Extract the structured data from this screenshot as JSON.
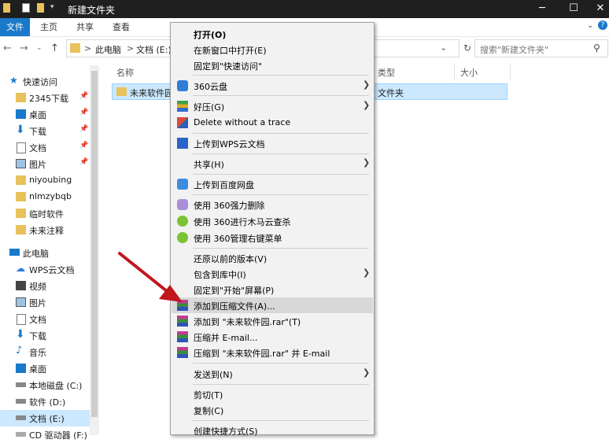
{
  "window": {
    "title": "新建文件夹"
  },
  "ribbon": {
    "tabs": [
      "文件",
      "主页",
      "共享",
      "查看"
    ]
  },
  "address": {
    "parts": [
      "此电脑",
      "文档 (E:)"
    ],
    "sep": ">",
    "search_placeholder": "搜索\"新建文件夹\""
  },
  "nav": {
    "quick_access": "快速访问",
    "items": [
      {
        "label": "2345下载",
        "pinned": true
      },
      {
        "label": "桌面",
        "pinned": true
      },
      {
        "label": "下载",
        "pinned": true
      },
      {
        "label": "文档",
        "pinned": true
      },
      {
        "label": "图片",
        "pinned": true
      },
      {
        "label": "niyoubing",
        "pinned": false
      },
      {
        "label": "nlmzybqb",
        "pinned": false
      },
      {
        "label": "临时软件",
        "pinned": false
      },
      {
        "label": "未来注释",
        "pinned": false
      }
    ],
    "this_pc": "此电脑",
    "pc_items": [
      "WPS云文档",
      "视频",
      "图片",
      "文档",
      "下载",
      "音乐",
      "桌面",
      "本地磁盘 (C:)",
      "软件 (D:)",
      "文档 (E:)",
      "CD 驱动器 (F:)"
    ]
  },
  "content": {
    "columns": {
      "name": "名称",
      "type": "类型",
      "size": "大小"
    },
    "folder": {
      "name": "未来软件园",
      "type": "文件夹"
    }
  },
  "context_menu": {
    "open": "打开(O)",
    "open_new_window": "在新窗口中打开(E)",
    "pin_quick": "固定到\"快速访问\"",
    "cloud360": "360云盘",
    "haozip": "好压(G)",
    "delete_trace": "Delete without a trace",
    "wps_upload": "上传到WPS云文档",
    "share": "共享(H)",
    "baidu_upload": "上传到百度网盘",
    "force_delete": "使用 360强力删除",
    "trojan_scan": "使用 360进行木马云查杀",
    "manage_menu": "使用 360管理右键菜单",
    "restore": "还原以前的版本(V)",
    "include_lib": "包含到库中(I)",
    "pin_start": "固定到\"开始\"屏幕(P)",
    "add_archive": "添加到压缩文件(A)...",
    "add_rar": "添加到 \"未来软件园.rar\"(T)",
    "compress_email": "压缩并 E-mail...",
    "compress_rar_email": "压缩到 \"未来软件园.rar\" 并 E-mail",
    "send_to": "发送到(N)",
    "cut": "剪切(T)",
    "copy": "复制(C)",
    "create_shortcut": "创建快捷方式(S)"
  },
  "colors": {
    "accent": "#1979ca",
    "selection": "#cce8ff",
    "arrow": "#c0161c"
  }
}
